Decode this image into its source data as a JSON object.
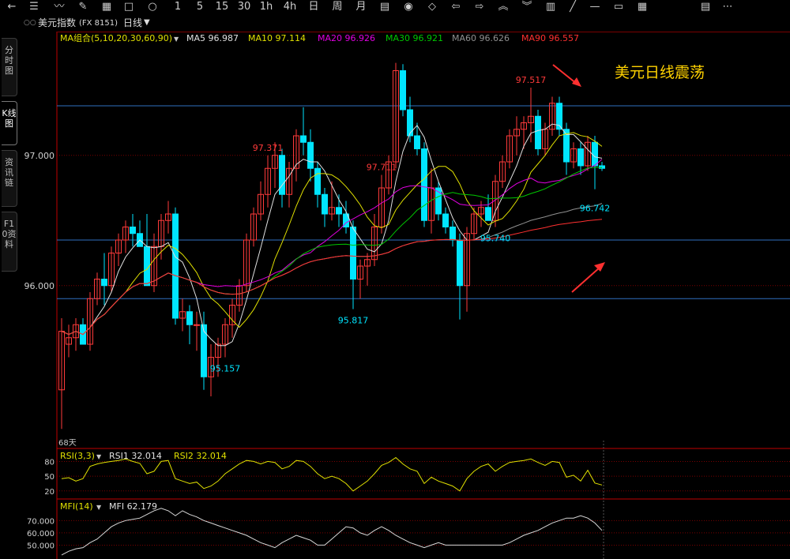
{
  "toolbar": {
    "items": [
      {
        "name": "back-arrow-icon",
        "glyph": "←"
      },
      {
        "name": "list-icon",
        "glyph": "☰"
      },
      {
        "name": "line-chart-icon",
        "glyph": "〰"
      },
      {
        "name": "edit-icon",
        "glyph": "✎"
      },
      {
        "name": "report-icon",
        "glyph": "▦"
      },
      {
        "name": "square-icon",
        "glyph": "□"
      },
      {
        "name": "circle-icon",
        "glyph": "○"
      },
      {
        "name": "period-1min-icon",
        "glyph": "1"
      },
      {
        "name": "period-5min-icon",
        "glyph": "5"
      },
      {
        "name": "period-15min-icon",
        "glyph": "15"
      },
      {
        "name": "period-30min-icon",
        "glyph": "30"
      },
      {
        "name": "period-1h-icon",
        "glyph": "1h"
      },
      {
        "name": "period-4h-icon",
        "glyph": "4h"
      },
      {
        "name": "period-day-icon",
        "glyph": "日"
      },
      {
        "name": "period-week-icon",
        "glyph": "周"
      },
      {
        "name": "period-month-icon",
        "glyph": "月"
      },
      {
        "name": "calendar-icon",
        "glyph": "▤"
      },
      {
        "name": "eye-icon",
        "glyph": "◉"
      },
      {
        "name": "diamond-icon",
        "glyph": "◇"
      },
      {
        "name": "arrow-left-icon",
        "glyph": "⇦"
      },
      {
        "name": "arrow-right-icon",
        "glyph": "⇨"
      },
      {
        "name": "double-up-icon",
        "glyph": "︽"
      },
      {
        "name": "double-down-icon",
        "glyph": "︾"
      },
      {
        "name": "bars-icon",
        "glyph": "▥"
      },
      {
        "name": "slash-line-icon",
        "glyph": "╱"
      },
      {
        "name": "dash-line-icon",
        "glyph": "—"
      },
      {
        "name": "hline-icon",
        "glyph": "▭"
      },
      {
        "name": "grid-icon",
        "glyph": "▦"
      },
      {
        "name": "table-icon",
        "glyph": "▤"
      },
      {
        "name": "more-icon",
        "glyph": "⋯"
      }
    ]
  },
  "header": {
    "dots": "○○",
    "title": "美元指数",
    "code": "(FX 8151)",
    "period": "日线"
  },
  "side_tabs": [
    {
      "label": "分时图",
      "active": false
    },
    {
      "label": "K线图",
      "active": true
    },
    {
      "label": "资讯链",
      "active": false
    },
    {
      "label": "F10资料",
      "active": false
    }
  ],
  "colors": {
    "up": "#ff3a3a",
    "down": "#00e5ff",
    "grid": "#7a0000",
    "hline": "#2f6fc0",
    "ma5": "#e0e0e0",
    "ma10": "#e0e000",
    "ma20": "#e000e0",
    "ma30": "#00c800",
    "ma60": "#909090",
    "ma90": "#ff3030",
    "annot": "#ffd200",
    "axis": "#c00000"
  },
  "chart_data": [
    {
      "type": "candlestick",
      "title": "美元日线震荡",
      "ylim": [
        94.75,
        97.95
      ],
      "y_ticks": [
        96.0,
        97.0
      ],
      "y_tick_labels": [
        "96.000",
        "97.000"
      ],
      "days_label": "68天",
      "ma_legend": {
        "label": "MA组合(5,10,20,30,60,90)",
        "series": [
          {
            "name": "MA5",
            "value": "96.987"
          },
          {
            "name": "MA10",
            "value": "97.114"
          },
          {
            "name": "MA20",
            "value": "96.926"
          },
          {
            "name": "MA30",
            "value": "96.921"
          },
          {
            "name": "MA60",
            "value": "96.626"
          },
          {
            "name": "MA90",
            "value": "96.557"
          }
        ]
      },
      "annotations": [
        {
          "text": "97.371",
          "index": 29
        },
        {
          "text": "97.711",
          "index": 45
        },
        {
          "text": "97.517",
          "index": 66
        },
        {
          "text": "95.817",
          "index": 41
        },
        {
          "text": "95.740",
          "index": 61
        },
        {
          "text": "95.157",
          "index": 23
        },
        {
          "text": "96.742",
          "index": 75
        }
      ],
      "horizontal_lines": [
        97.38,
        96.35,
        95.9
      ],
      "candles": [
        {
          "o": 95.2,
          "h": 95.75,
          "l": 94.9,
          "c": 95.65
        },
        {
          "o": 95.55,
          "h": 95.7,
          "l": 95.45,
          "c": 95.6
        },
        {
          "o": 95.6,
          "h": 95.75,
          "l": 95.5,
          "c": 95.7
        },
        {
          "o": 95.7,
          "h": 95.75,
          "l": 95.55,
          "c": 95.55
        },
        {
          "o": 95.55,
          "h": 95.95,
          "l": 95.5,
          "c": 95.9
        },
        {
          "o": 95.9,
          "h": 96.1,
          "l": 95.85,
          "c": 96.05
        },
        {
          "o": 96.05,
          "h": 96.25,
          "l": 95.85,
          "c": 96.0
        },
        {
          "o": 96.0,
          "h": 96.3,
          "l": 95.95,
          "c": 96.25
        },
        {
          "o": 96.25,
          "h": 96.4,
          "l": 96.15,
          "c": 96.35
        },
        {
          "o": 96.35,
          "h": 96.5,
          "l": 96.25,
          "c": 96.45
        },
        {
          "o": 96.45,
          "h": 96.55,
          "l": 96.3,
          "c": 96.4
        },
        {
          "o": 96.4,
          "h": 96.5,
          "l": 96.3,
          "c": 96.3
        },
        {
          "o": 96.3,
          "h": 96.55,
          "l": 96.1,
          "c": 96.0
        },
        {
          "o": 96.0,
          "h": 96.4,
          "l": 95.95,
          "c": 96.3
        },
        {
          "o": 96.3,
          "h": 96.55,
          "l": 96.2,
          "c": 96.5
        },
        {
          "o": 96.5,
          "h": 96.65,
          "l": 96.4,
          "c": 96.55
        },
        {
          "o": 96.55,
          "h": 96.6,
          "l": 95.7,
          "c": 95.75
        },
        {
          "o": 95.75,
          "h": 95.9,
          "l": 95.65,
          "c": 95.8
        },
        {
          "o": 95.8,
          "h": 95.85,
          "l": 95.55,
          "c": 95.7
        },
        {
          "o": 95.7,
          "h": 95.8,
          "l": 95.5,
          "c": 95.7
        },
        {
          "o": 95.7,
          "h": 95.8,
          "l": 95.2,
          "c": 95.3
        },
        {
          "o": 95.3,
          "h": 95.55,
          "l": 95.15,
          "c": 95.45
        },
        {
          "o": 95.45,
          "h": 95.6,
          "l": 95.3,
          "c": 95.55
        },
        {
          "o": 95.55,
          "h": 95.75,
          "l": 95.45,
          "c": 95.7
        },
        {
          "o": 95.7,
          "h": 95.9,
          "l": 95.6,
          "c": 95.85
        },
        {
          "o": 95.85,
          "h": 96.05,
          "l": 95.8,
          "c": 96.0
        },
        {
          "o": 96.0,
          "h": 96.4,
          "l": 95.95,
          "c": 96.35
        },
        {
          "o": 96.35,
          "h": 96.6,
          "l": 96.3,
          "c": 96.55
        },
        {
          "o": 96.55,
          "h": 96.8,
          "l": 96.5,
          "c": 96.7
        },
        {
          "o": 96.7,
          "h": 97.0,
          "l": 96.6,
          "c": 96.9
        },
        {
          "o": 96.9,
          "h": 97.1,
          "l": 96.75,
          "c": 97.0
        },
        {
          "o": 97.0,
          "h": 97.05,
          "l": 96.6,
          "c": 96.7
        },
        {
          "o": 96.7,
          "h": 96.95,
          "l": 96.6,
          "c": 96.9
        },
        {
          "o": 96.9,
          "h": 97.2,
          "l": 96.8,
          "c": 97.15
        },
        {
          "o": 97.15,
          "h": 97.37,
          "l": 97.0,
          "c": 97.1
        },
        {
          "o": 97.1,
          "h": 97.2,
          "l": 96.8,
          "c": 96.9
        },
        {
          "o": 96.9,
          "h": 96.95,
          "l": 96.6,
          "c": 96.7
        },
        {
          "o": 96.7,
          "h": 96.75,
          "l": 96.45,
          "c": 96.55
        },
        {
          "o": 96.55,
          "h": 96.8,
          "l": 96.5,
          "c": 96.6
        },
        {
          "o": 96.6,
          "h": 96.7,
          "l": 96.45,
          "c": 96.55
        },
        {
          "o": 96.55,
          "h": 96.65,
          "l": 96.4,
          "c": 96.45
        },
        {
          "o": 96.45,
          "h": 96.5,
          "l": 95.82,
          "c": 96.05
        },
        {
          "o": 96.05,
          "h": 96.2,
          "l": 95.9,
          "c": 96.15
        },
        {
          "o": 96.15,
          "h": 96.25,
          "l": 96.0,
          "c": 96.2
        },
        {
          "o": 96.2,
          "h": 96.55,
          "l": 96.15,
          "c": 96.45
        },
        {
          "o": 96.45,
          "h": 96.85,
          "l": 96.4,
          "c": 96.75
        },
        {
          "o": 96.75,
          "h": 97.0,
          "l": 96.7,
          "c": 96.95
        },
        {
          "o": 96.95,
          "h": 97.71,
          "l": 96.9,
          "c": 97.65
        },
        {
          "o": 97.65,
          "h": 97.7,
          "l": 97.3,
          "c": 97.35
        },
        {
          "o": 97.35,
          "h": 97.45,
          "l": 97.1,
          "c": 97.15
        },
        {
          "o": 97.15,
          "h": 97.25,
          "l": 97.0,
          "c": 97.05
        },
        {
          "o": 97.05,
          "h": 97.1,
          "l": 96.45,
          "c": 96.5
        },
        {
          "o": 96.5,
          "h": 96.9,
          "l": 96.4,
          "c": 96.75
        },
        {
          "o": 96.75,
          "h": 96.8,
          "l": 96.5,
          "c": 96.55
        },
        {
          "o": 96.55,
          "h": 96.6,
          "l": 96.4,
          "c": 96.45
        },
        {
          "o": 96.45,
          "h": 96.5,
          "l": 96.3,
          "c": 96.35
        },
        {
          "o": 96.35,
          "h": 96.4,
          "l": 95.74,
          "c": 96.0
        },
        {
          "o": 96.0,
          "h": 96.45,
          "l": 95.8,
          "c": 96.4
        },
        {
          "o": 96.4,
          "h": 96.6,
          "l": 96.35,
          "c": 96.55
        },
        {
          "o": 96.55,
          "h": 96.65,
          "l": 96.45,
          "c": 96.6
        },
        {
          "o": 96.6,
          "h": 96.7,
          "l": 96.5,
          "c": 96.5
        },
        {
          "o": 96.5,
          "h": 96.85,
          "l": 96.45,
          "c": 96.8
        },
        {
          "o": 96.8,
          "h": 97.0,
          "l": 96.75,
          "c": 96.95
        },
        {
          "o": 96.95,
          "h": 97.2,
          "l": 96.9,
          "c": 97.15
        },
        {
          "o": 97.15,
          "h": 97.3,
          "l": 97.0,
          "c": 97.2
        },
        {
          "o": 97.2,
          "h": 97.3,
          "l": 97.05,
          "c": 97.25
        },
        {
          "o": 97.25,
          "h": 97.52,
          "l": 97.1,
          "c": 97.3
        },
        {
          "o": 97.3,
          "h": 97.35,
          "l": 97.0,
          "c": 97.05
        },
        {
          "o": 97.05,
          "h": 97.25,
          "l": 97.0,
          "c": 97.2
        },
        {
          "o": 97.2,
          "h": 97.45,
          "l": 97.15,
          "c": 97.4
        },
        {
          "o": 97.4,
          "h": 97.45,
          "l": 97.15,
          "c": 97.2
        },
        {
          "o": 97.2,
          "h": 97.25,
          "l": 96.85,
          "c": 96.95
        },
        {
          "o": 96.95,
          "h": 97.1,
          "l": 96.9,
          "c": 97.05
        },
        {
          "o": 97.05,
          "h": 97.1,
          "l": 96.85,
          "c": 96.92
        },
        {
          "o": 96.92,
          "h": 97.15,
          "l": 96.88,
          "c": 97.1
        },
        {
          "o": 97.1,
          "h": 97.15,
          "l": 96.74,
          "c": 96.92
        },
        {
          "o": 96.92,
          "h": 96.95,
          "l": 96.88,
          "c": 96.9
        }
      ]
    },
    {
      "type": "line",
      "label": "RSI(3,3)",
      "legend": [
        {
          "name": "RSI1",
          "value": "32.014"
        },
        {
          "name": "RSI2",
          "value": "32.014"
        }
      ],
      "ylim": [
        10,
        100
      ],
      "y_ticks": [
        20,
        50,
        80
      ],
      "y_tick_labels": [
        "20",
        "50",
        "80"
      ],
      "values": [
        45,
        47,
        40,
        45,
        70,
        75,
        78,
        80,
        82,
        85,
        80,
        76,
        55,
        60,
        80,
        82,
        45,
        40,
        35,
        38,
        25,
        30,
        40,
        55,
        65,
        75,
        82,
        80,
        75,
        80,
        78,
        65,
        70,
        82,
        80,
        70,
        55,
        45,
        50,
        45,
        35,
        20,
        30,
        40,
        55,
        72,
        78,
        88,
        75,
        65,
        60,
        35,
        48,
        40,
        35,
        30,
        20,
        45,
        60,
        70,
        75,
        60,
        70,
        78,
        80,
        82,
        85,
        78,
        72,
        80,
        78,
        48,
        52,
        40,
        62,
        36,
        32
      ]
    },
    {
      "type": "line",
      "label": "MFI(14)",
      "legend": [
        {
          "name": "MFI",
          "value": "62.179"
        }
      ],
      "ylim": [
        40,
        85
      ],
      "y_ticks": [
        50,
        60,
        70
      ],
      "y_tick_labels": [
        "50.000",
        "60.000",
        "70.000"
      ],
      "values": [
        42,
        45,
        47,
        48,
        52,
        55,
        60,
        65,
        68,
        70,
        71,
        72,
        75,
        78,
        80,
        78,
        74,
        78,
        75,
        73,
        70,
        68,
        66,
        64,
        62,
        60,
        58,
        55,
        52,
        50,
        48,
        52,
        55,
        58,
        56,
        54,
        50,
        50,
        55,
        60,
        65,
        64,
        60,
        58,
        62,
        65,
        62,
        58,
        55,
        52,
        50,
        48,
        50,
        52,
        50,
        50,
        50,
        50,
        50,
        50,
        50,
        50,
        50,
        52,
        55,
        58,
        60,
        62,
        65,
        68,
        70,
        72,
        72,
        74,
        72,
        68,
        62
      ]
    }
  ]
}
